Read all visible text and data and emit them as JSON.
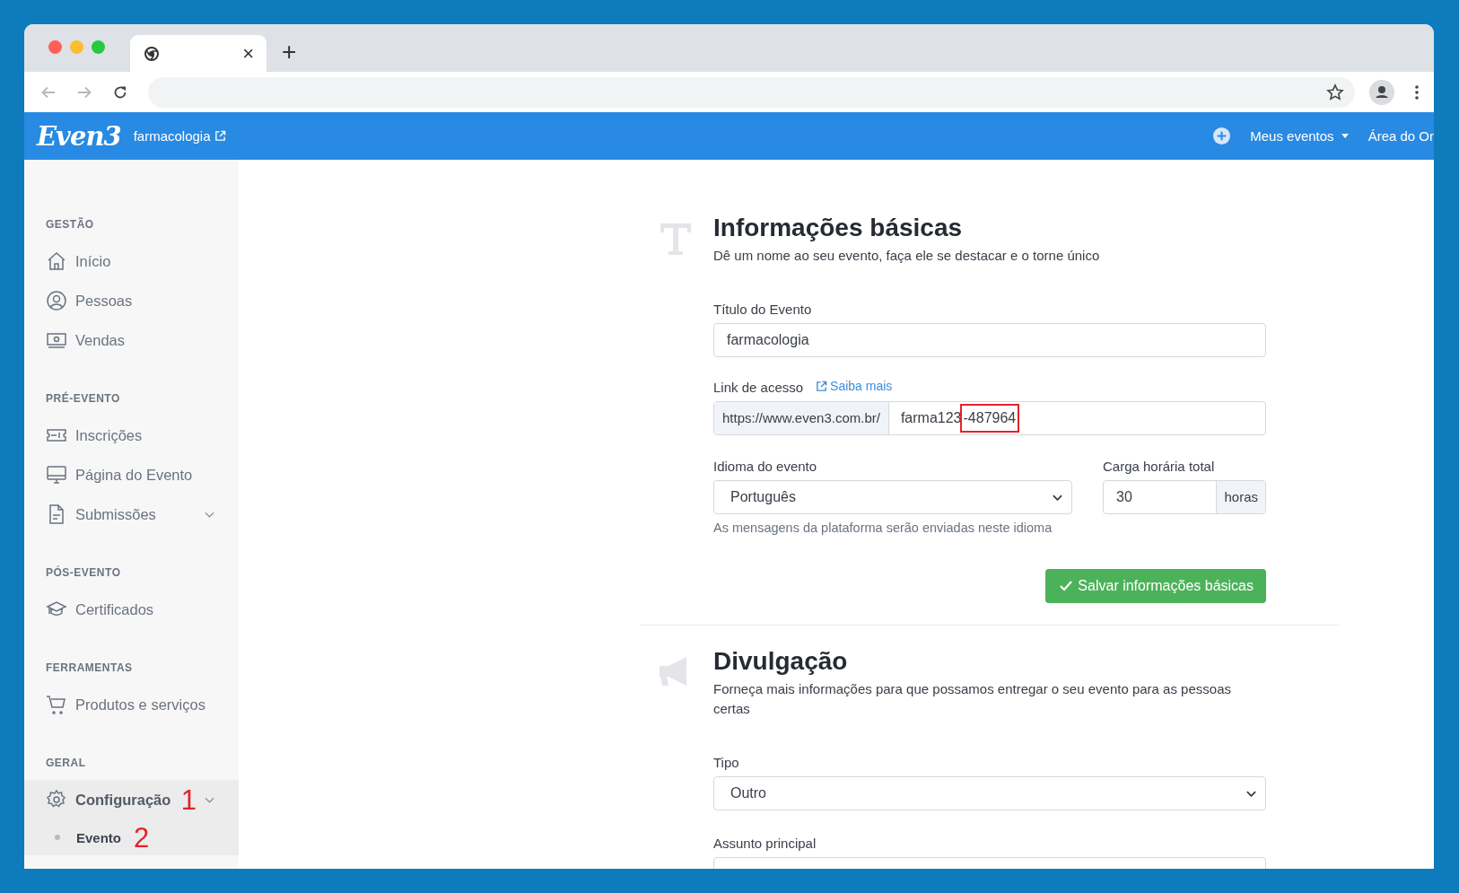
{
  "browser": {
    "tab_close": "×",
    "new_tab": "+"
  },
  "header": {
    "logo": "Even3",
    "event_link": "farmacologia",
    "nav": [
      {
        "label": "Meus eventos",
        "dropdown": true
      },
      {
        "label": "Área do Or",
        "dropdown": false
      }
    ]
  },
  "sidebar": {
    "sections": [
      {
        "title": "GESTÃO",
        "items": [
          {
            "label": "Início",
            "kind": "home",
            "selected": false
          },
          {
            "label": "Pessoas",
            "kind": "user",
            "selected": false
          },
          {
            "label": "Vendas",
            "kind": "money",
            "selected": false
          }
        ]
      },
      {
        "title": "PRÉ-EVENTO",
        "items": [
          {
            "label": "Inscrições",
            "kind": "ticket",
            "selected": false
          },
          {
            "label": "Página do Evento",
            "kind": "monitor",
            "selected": false
          },
          {
            "label": "Submissões",
            "kind": "file",
            "selected": false,
            "expandable": true
          }
        ]
      },
      {
        "title": "PÓS-EVENTO",
        "items": [
          {
            "label": "Certificados",
            "kind": "cap",
            "selected": false
          }
        ]
      },
      {
        "title": "FERRAMENTAS",
        "items": [
          {
            "label": "Produtos e serviços",
            "kind": "cart",
            "selected": false
          }
        ]
      },
      {
        "title": "GERAL",
        "items": [
          {
            "label": "Configuração",
            "kind": "gear",
            "selected": true,
            "expandable": true,
            "annotation": "1",
            "children": [
              {
                "label": "Evento",
                "selected": true,
                "annotation": "2"
              }
            ]
          }
        ]
      }
    ]
  },
  "basic": {
    "kind": "text",
    "title": "Informações básicas",
    "subtitle": "Dê um nome ao seu evento, faça ele se destacar e o torne único",
    "event_title": {
      "label": "Título do Evento",
      "value": "farmacologia"
    },
    "access_link": {
      "label": "Link de acesso",
      "help_link": "Saiba mais",
      "prefix": "https://www.even3.com.br/",
      "slug_parts": [
        {
          "text": "farma123",
          "highlighted": false
        },
        {
          "text": "-487964",
          "highlighted": true
        }
      ]
    },
    "language": {
      "label": "Idioma do evento",
      "value": "Português",
      "hint": "As mensagens da plataforma serão enviadas neste idioma"
    },
    "hours": {
      "label": "Carga horária total",
      "value": "30",
      "unit": "horas"
    },
    "save_button": "Salvar informações básicas"
  },
  "promotion": {
    "kind": "megaphone",
    "title": "Divulgação",
    "subtitle": "Forneça mais informações para que possamos entregar o seu evento para as pessoas certas",
    "fields": [
      {
        "label": "Tipo",
        "value": "Outro"
      },
      {
        "label": "Assunto principal"
      }
    ]
  }
}
